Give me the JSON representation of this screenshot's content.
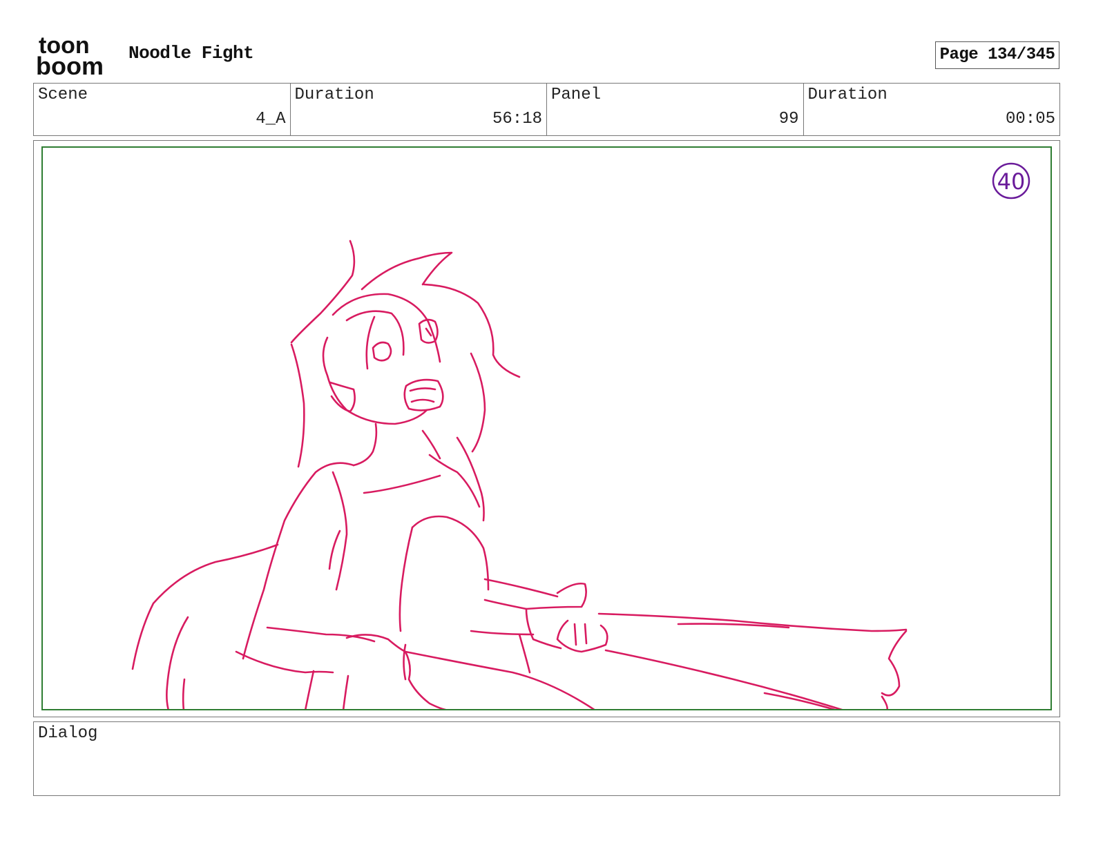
{
  "header": {
    "logo_line1": "toon",
    "logo_line2": "boom",
    "title": "Noodle Fight",
    "page": "Page 134/345"
  },
  "info": [
    {
      "label": "Scene",
      "value": "4_A"
    },
    {
      "label": "Duration",
      "value": "56:18"
    },
    {
      "label": "Panel",
      "value": "99"
    },
    {
      "label": "Duration",
      "value": "00:05"
    }
  ],
  "panel": {
    "number_marker": "40",
    "frame_color": "#2e7d32",
    "sketch_color": "#d81b60",
    "marker_color": "#6a1b9a"
  },
  "dialog": {
    "label": "Dialog",
    "text": ""
  }
}
